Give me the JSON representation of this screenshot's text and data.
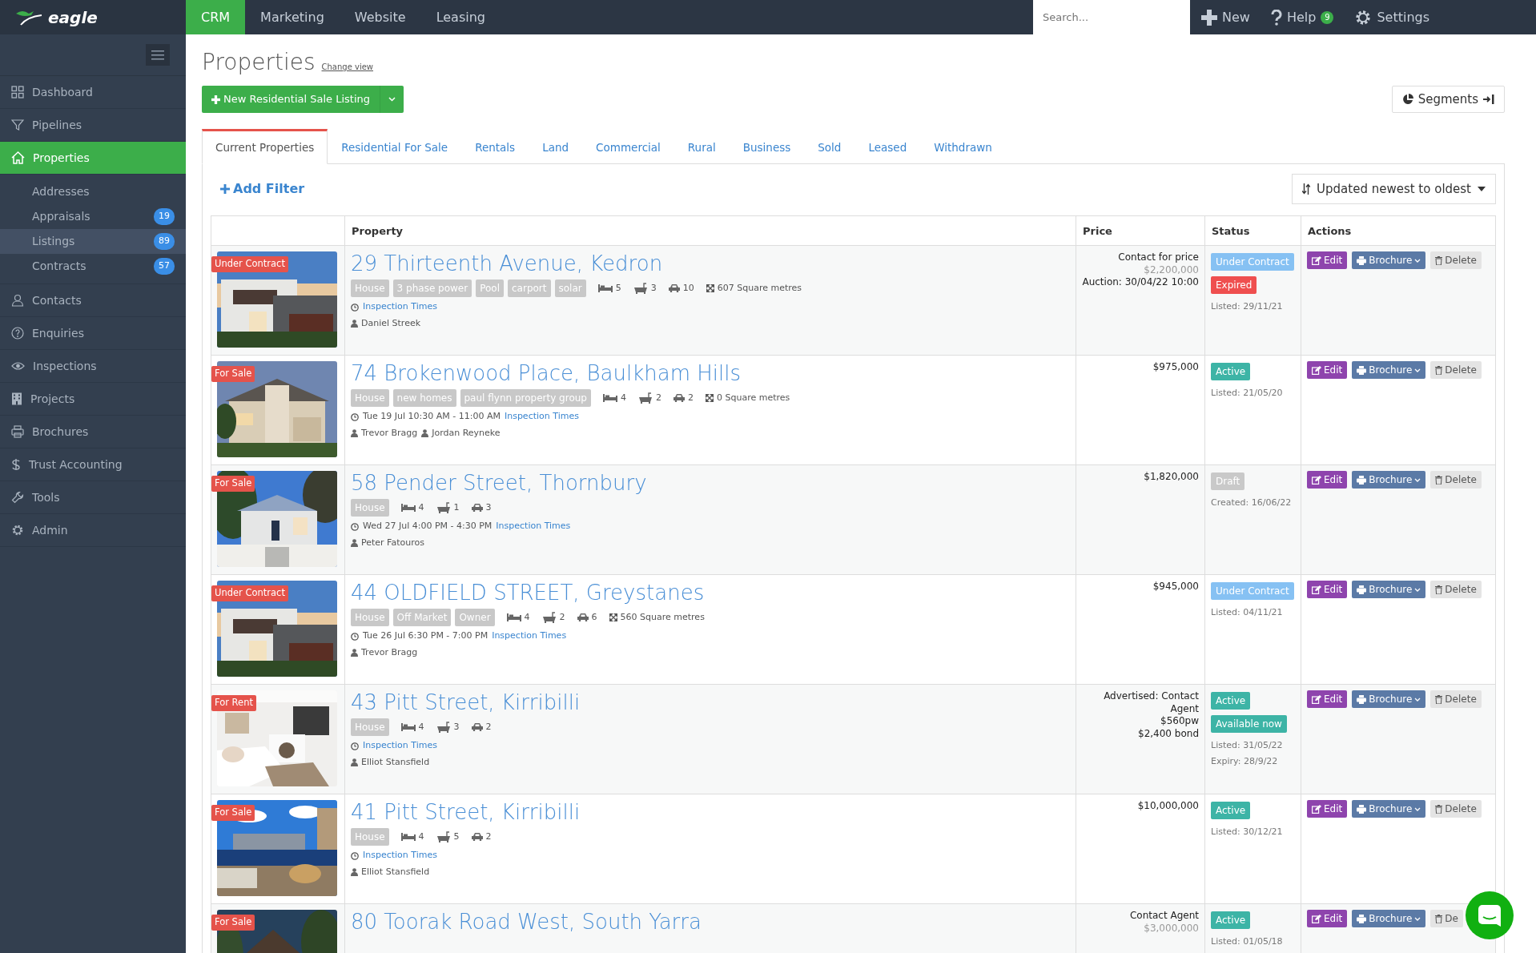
{
  "brand": {
    "name": "eagle"
  },
  "top_nav": [
    {
      "label": "CRM",
      "selected": true
    },
    {
      "label": "Marketing",
      "selected": false
    },
    {
      "label": "Website",
      "selected": false
    },
    {
      "label": "Leasing",
      "selected": false
    }
  ],
  "search": {
    "placeholder": "Search..."
  },
  "top_actions": [
    {
      "label": "New"
    },
    {
      "label": "Help",
      "badge": "9"
    },
    {
      "label": "Settings"
    }
  ],
  "sidebar": {
    "items": [
      {
        "label": "Dashboard",
        "selected": false
      },
      {
        "label": "Pipelines",
        "selected": false
      },
      {
        "label": "Properties",
        "selected": true,
        "children": [
          {
            "label": "Addresses",
            "selected": false
          },
          {
            "label": "Appraisals",
            "badge": "19",
            "selected": false
          },
          {
            "label": "Listings",
            "badge": "89",
            "selected": true
          },
          {
            "label": "Contracts",
            "badge": "57",
            "selected": false
          }
        ]
      },
      {
        "label": "Contacts",
        "selected": false
      },
      {
        "label": "Enquiries",
        "selected": false
      },
      {
        "label": "Inspections",
        "selected": false
      },
      {
        "label": "Projects",
        "selected": false
      },
      {
        "label": "Brochures",
        "selected": false
      },
      {
        "label": "Trust Accounting",
        "selected": false
      },
      {
        "label": "Tools",
        "selected": false
      },
      {
        "label": "Admin",
        "selected": false
      }
    ]
  },
  "page": {
    "title": "Properties",
    "change_view": "Change view",
    "new_button": "New Residential Sale Listing",
    "segments_button": "Segments"
  },
  "tabs": [
    {
      "label": "Current Properties",
      "selected": true
    },
    {
      "label": "Residential For Sale",
      "selected": false
    },
    {
      "label": "Rentals",
      "selected": false
    },
    {
      "label": "Land",
      "selected": false
    },
    {
      "label": "Commercial",
      "selected": false
    },
    {
      "label": "Rural",
      "selected": false
    },
    {
      "label": "Business",
      "selected": false
    },
    {
      "label": "Sold",
      "selected": false
    },
    {
      "label": "Leased",
      "selected": false
    },
    {
      "label": "Withdrawn",
      "selected": false
    }
  ],
  "filter": {
    "add_filter": "Add Filter",
    "sort": "Updated newest to oldest"
  },
  "table": {
    "columns": [
      "Property",
      "Price",
      "Status",
      "Actions"
    ],
    "rows": [
      {
        "ribbon": "Under Contract",
        "title": "29 Thirteenth Avenue, Kedron",
        "tags": [
          "House",
          "3 phase power",
          "Pool",
          "carport",
          "solar"
        ],
        "features": {
          "beds": "5",
          "baths": "3",
          "cars": "10",
          "area": "607 Square metres"
        },
        "inspection": {
          "link": "Inspection Times"
        },
        "agents": [
          "Daniel Streek"
        ],
        "price": [
          {
            "text": "Contact for price",
            "kind": "main"
          },
          {
            "text": "$2,200,000",
            "kind": "muted"
          },
          {
            "text": "Auction: 30/04/22 10:00",
            "kind": "main"
          }
        ],
        "statuses": [
          {
            "label": "Under Contract",
            "kind": "under_contract"
          },
          {
            "label": "Expired",
            "kind": "expired"
          }
        ],
        "dates": [
          "Listed: 29/11/21"
        ],
        "actions": {
          "edit": "Edit",
          "brochure": "Brochure",
          "delete": "Delete"
        }
      },
      {
        "ribbon": "For Sale",
        "title": "74 Brokenwood Place, Baulkham Hills",
        "tags": [
          "House",
          "new homes",
          "paul flynn property group"
        ],
        "features": {
          "beds": "4",
          "baths": "2",
          "cars": "2",
          "area": "0 Square metres"
        },
        "inspection": {
          "time": "Tue 19 Jul 10:30 AM - 11:00 AM",
          "link": "Inspection Times"
        },
        "agents": [
          "Trevor Bragg",
          "Jordan Reyneke"
        ],
        "price": [
          {
            "text": "$975,000",
            "kind": "main"
          }
        ],
        "statuses": [
          {
            "label": "Active",
            "kind": "active"
          }
        ],
        "dates": [
          "Listed: 21/05/20"
        ],
        "actions": {
          "edit": "Edit",
          "brochure": "Brochure",
          "delete": "Delete"
        }
      },
      {
        "ribbon": "For Sale",
        "title": "58 Pender Street, Thornbury",
        "tags": [
          "House"
        ],
        "features": {
          "beds": "4",
          "baths": "1",
          "cars": "3"
        },
        "inspection": {
          "time": "Wed 27 Jul 4:00 PM - 4:30 PM",
          "link": "Inspection Times"
        },
        "agents": [
          "Peter Fatouros"
        ],
        "price": [
          {
            "text": "$1,820,000",
            "kind": "main"
          }
        ],
        "statuses": [
          {
            "label": "Draft",
            "kind": "draft"
          }
        ],
        "dates": [
          "Created: 16/06/22"
        ],
        "actions": {
          "edit": "Edit",
          "brochure": "Brochure",
          "delete": "Delete"
        }
      },
      {
        "ribbon": "Under Contract",
        "title": "44 OLDFIELD STREET, Greystanes",
        "tags": [
          "House",
          "Off Market",
          "Owner"
        ],
        "features": {
          "beds": "4",
          "baths": "2",
          "cars": "6",
          "area": "560 Square metres"
        },
        "inspection": {
          "time": "Tue 26 Jul 6:30 PM - 7:00 PM",
          "link": "Inspection Times"
        },
        "agents": [
          "Trevor Bragg"
        ],
        "price": [
          {
            "text": "$945,000",
            "kind": "main"
          }
        ],
        "statuses": [
          {
            "label": "Under Contract",
            "kind": "under_contract"
          }
        ],
        "dates": [
          "Listed: 04/11/21"
        ],
        "actions": {
          "edit": "Edit",
          "brochure": "Brochure",
          "delete": "Delete"
        }
      },
      {
        "ribbon": "For Rent",
        "title": "43 Pitt Street, Kirribilli",
        "tags": [
          "House"
        ],
        "features": {
          "beds": "4",
          "baths": "3",
          "cars": "2"
        },
        "inspection": {
          "link": "Inspection Times"
        },
        "agents": [
          "Elliot Stansfield"
        ],
        "price": [
          {
            "text": "Advertised: Contact Agent",
            "kind": "main"
          },
          {
            "text": "$560pw",
            "kind": "main"
          },
          {
            "text": "$2,400 bond",
            "kind": "main"
          }
        ],
        "statuses": [
          {
            "label": "Active",
            "kind": "active"
          },
          {
            "label": "Available now",
            "kind": "active"
          }
        ],
        "dates": [
          "Listed: 31/05/22",
          "Expiry: 28/9/22"
        ],
        "actions": {
          "edit": "Edit",
          "brochure": "Brochure",
          "delete": "Delete"
        }
      },
      {
        "ribbon": "For Sale",
        "title": "41 Pitt Street, Kirribilli",
        "tags": [
          "House"
        ],
        "features": {
          "beds": "4",
          "baths": "5",
          "cars": "2"
        },
        "inspection": {
          "link": "Inspection Times"
        },
        "agents": [
          "Elliot Stansfield"
        ],
        "price": [
          {
            "text": "$10,000,000",
            "kind": "main"
          }
        ],
        "statuses": [
          {
            "label": "Active",
            "kind": "active"
          }
        ],
        "dates": [
          "Listed: 30/12/21"
        ],
        "actions": {
          "edit": "Edit",
          "brochure": "Brochure",
          "delete": "Delete"
        }
      },
      {
        "ribbon": "For Sale",
        "title": "80 Toorak Road West, South Yarra",
        "price": [
          {
            "text": "Contact Agent",
            "kind": "main"
          },
          {
            "text": "$3,000,000",
            "kind": "muted"
          }
        ],
        "statuses": [
          {
            "label": "Active",
            "kind": "active"
          }
        ],
        "dates": [
          "Listed: 01/05/18"
        ],
        "actions": {
          "edit": "Edit",
          "brochure": "Brochure",
          "delete": "De"
        }
      }
    ]
  }
}
